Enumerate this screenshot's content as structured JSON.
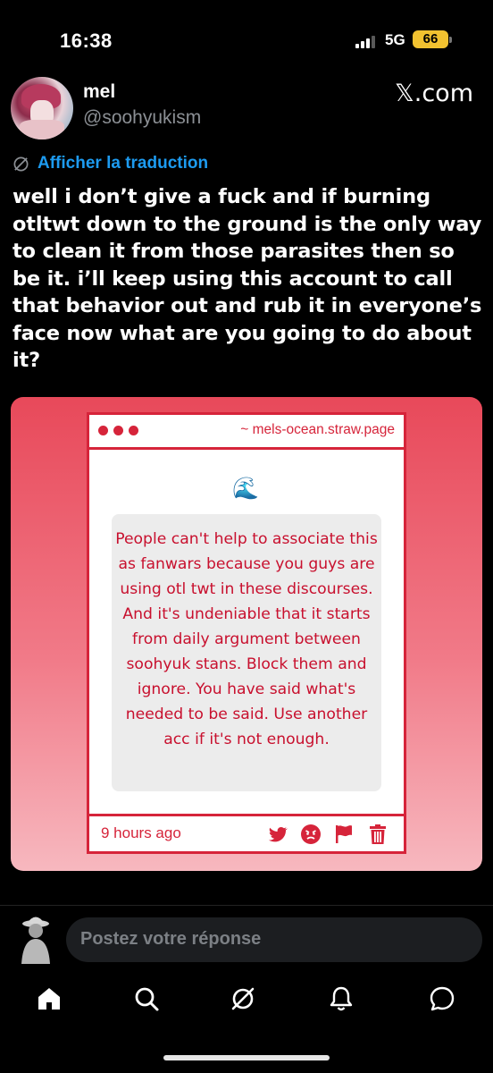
{
  "status_bar": {
    "time": "16:38",
    "network": "5G",
    "battery": "66"
  },
  "author": {
    "name": "mel",
    "handle": "@soohyukism",
    "source": "𝕏.com"
  },
  "translate_label": "Afficher la traduction",
  "tweet_text": "well i don’t give a fuck and if burning otltwt down to the ground is the only way to clean it from those parasites then so be it. i’ll keep using this account to call that behavior out and rub it in everyone’s face now what are you going to do about it?",
  "embed": {
    "url": "~ mels-ocean.straw.page",
    "emoji": "🌊",
    "question": "People can't help to associate this as fanwars because you guys are using otl twt in these discourses. And it's undeniable that it starts from daily argument between soohyuk stans. Block them and ignore. You have said what's needed to be said. Use another acc if it's not enough.",
    "timestamp": "9 hours ago",
    "icons": [
      "twitter-bird-icon",
      "angry-face-icon",
      "flag-icon",
      "trash-icon"
    ],
    "accent_color": "#d6243a"
  },
  "reply": {
    "placeholder": "Postez votre réponse"
  },
  "tabs": [
    "home-icon",
    "search-icon",
    "grok-icon",
    "notifications-icon",
    "messages-icon"
  ]
}
